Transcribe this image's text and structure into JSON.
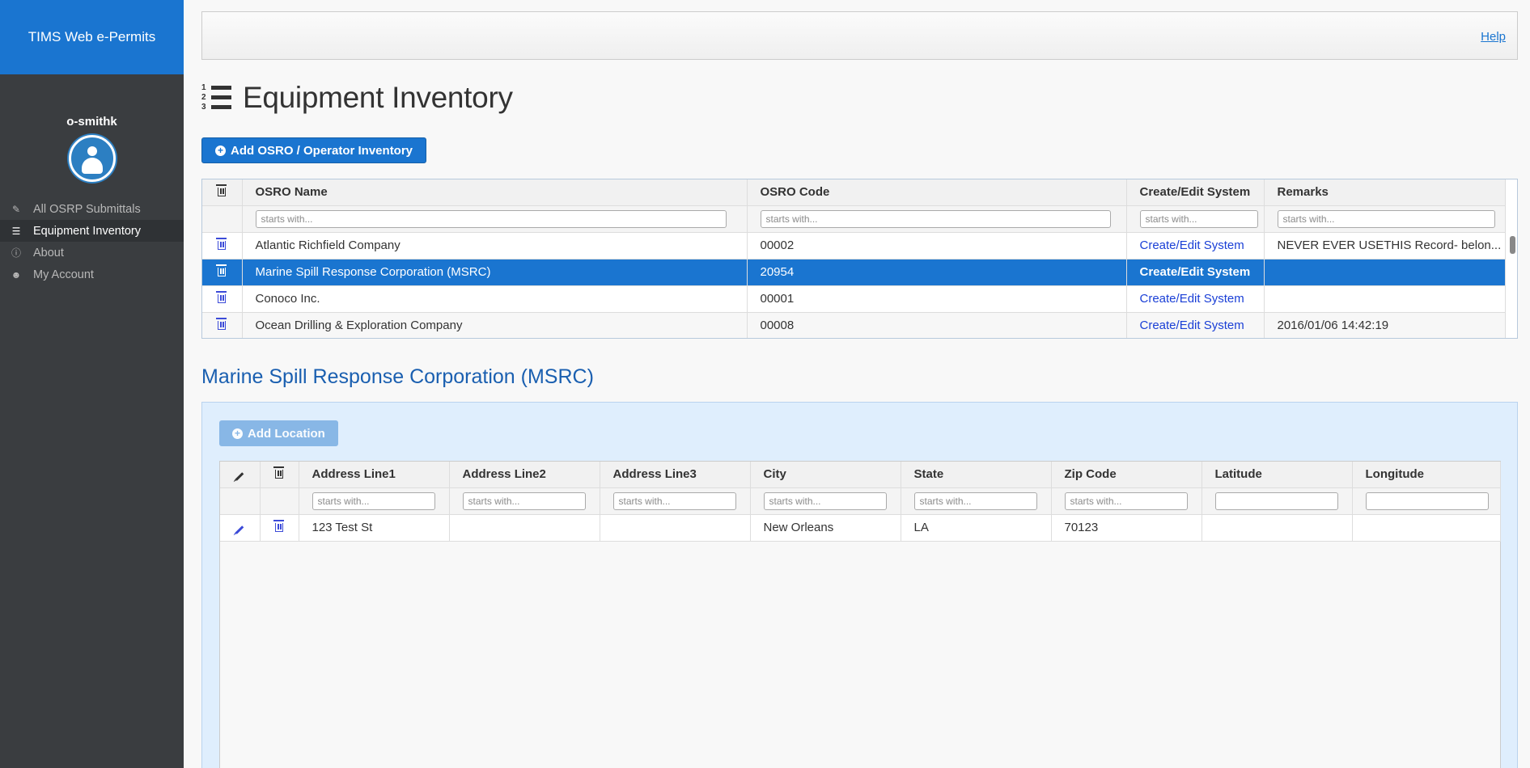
{
  "app": {
    "title": "TIMS Web e-Permits"
  },
  "user": {
    "name": "o-smithk"
  },
  "nav": [
    {
      "label": "All OSRP Submittals",
      "icon": "edit-icon",
      "active": false
    },
    {
      "label": "Equipment Inventory",
      "icon": "list-icon",
      "active": true
    },
    {
      "label": "About",
      "icon": "info-icon",
      "active": false
    },
    {
      "label": "My Account",
      "icon": "user-icon",
      "active": false
    }
  ],
  "topbar": {
    "help": "Help"
  },
  "page": {
    "title": "Equipment Inventory",
    "add_button": "Add OSRO / Operator Inventory"
  },
  "inventory_grid": {
    "columns": [
      "OSRO Name",
      "OSRO Code",
      "Create/Edit System",
      "Remarks"
    ],
    "filter_placeholder": "starts with...",
    "rows": [
      {
        "name": "Atlantic Richfield Company",
        "code": "00002",
        "link": "Create/Edit System",
        "remarks": "NEVER EVER USETHIS Record- belon..."
      },
      {
        "name": "Marine Spill Response Corporation (MSRC)",
        "code": "20954",
        "link": "Create/Edit System",
        "remarks": ""
      },
      {
        "name": "Conoco Inc.",
        "code": "00001",
        "link": "Create/Edit System",
        "remarks": ""
      },
      {
        "name": "Ocean Drilling & Exploration Company",
        "code": "00008",
        "link": "Create/Edit System",
        "remarks": "2016/01/06 14:42:19"
      }
    ]
  },
  "detail": {
    "title": "Marine Spill Response Corporation (MSRC)",
    "add_location": "Add Location"
  },
  "location_grid": {
    "columns": [
      "Address Line1",
      "Address Line2",
      "Address Line3",
      "City",
      "State",
      "Zip Code",
      "Latitude",
      "Longitude"
    ],
    "filter_placeholder": "starts with...",
    "rows": [
      {
        "line1": "123 Test St",
        "line2": "",
        "line3": "",
        "city": "New Orleans",
        "state": "LA",
        "zip": "70123",
        "lat": "",
        "lon": ""
      }
    ]
  },
  "colors": {
    "brand": "#1a75d0",
    "sidebar": "#3a3d40",
    "link": "#1a3fd6"
  }
}
